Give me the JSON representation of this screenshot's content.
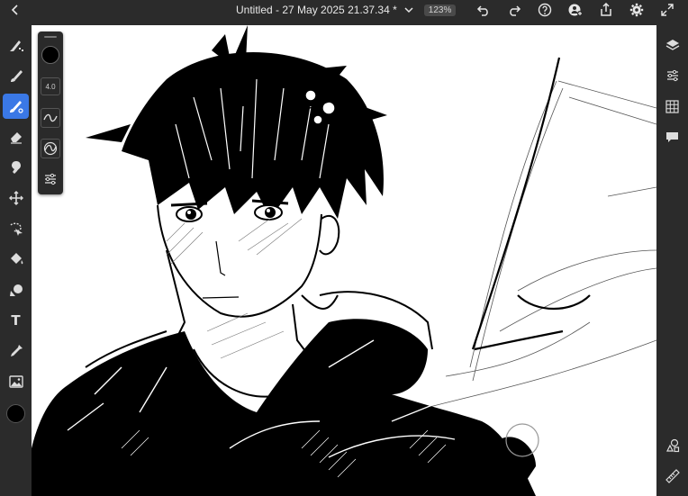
{
  "header": {
    "title": "Untitled - 27 May 2025 21.37.34 *",
    "zoom": "123%"
  },
  "brush_panel": {
    "size_value": "4.0",
    "color": "#000000"
  },
  "left_tools": [
    {
      "icon": "pixel-brush-icon"
    },
    {
      "icon": "live-brush-icon"
    },
    {
      "icon": "vector-brush-icon",
      "active": true
    },
    {
      "icon": "eraser-icon"
    },
    {
      "icon": "smudge-icon"
    },
    {
      "icon": "move-icon"
    },
    {
      "icon": "selection-icon"
    },
    {
      "icon": "fill-icon"
    },
    {
      "icon": "shape-icon"
    },
    {
      "icon": "text-icon",
      "label": "T"
    },
    {
      "icon": "eyedropper-icon"
    },
    {
      "icon": "image-icon"
    }
  ],
  "right_tools": [
    {
      "icon": "layers-icon"
    },
    {
      "icon": "adjustments-icon"
    },
    {
      "icon": "grid-icon"
    },
    {
      "icon": "comment-icon"
    },
    {
      "icon": "shapes-icon"
    },
    {
      "icon": "ruler-icon"
    }
  ],
  "colors": {
    "accent": "#3a78e6",
    "background": "#2b2b2b",
    "canvas": "#ffffff",
    "current_color": "#000000"
  }
}
